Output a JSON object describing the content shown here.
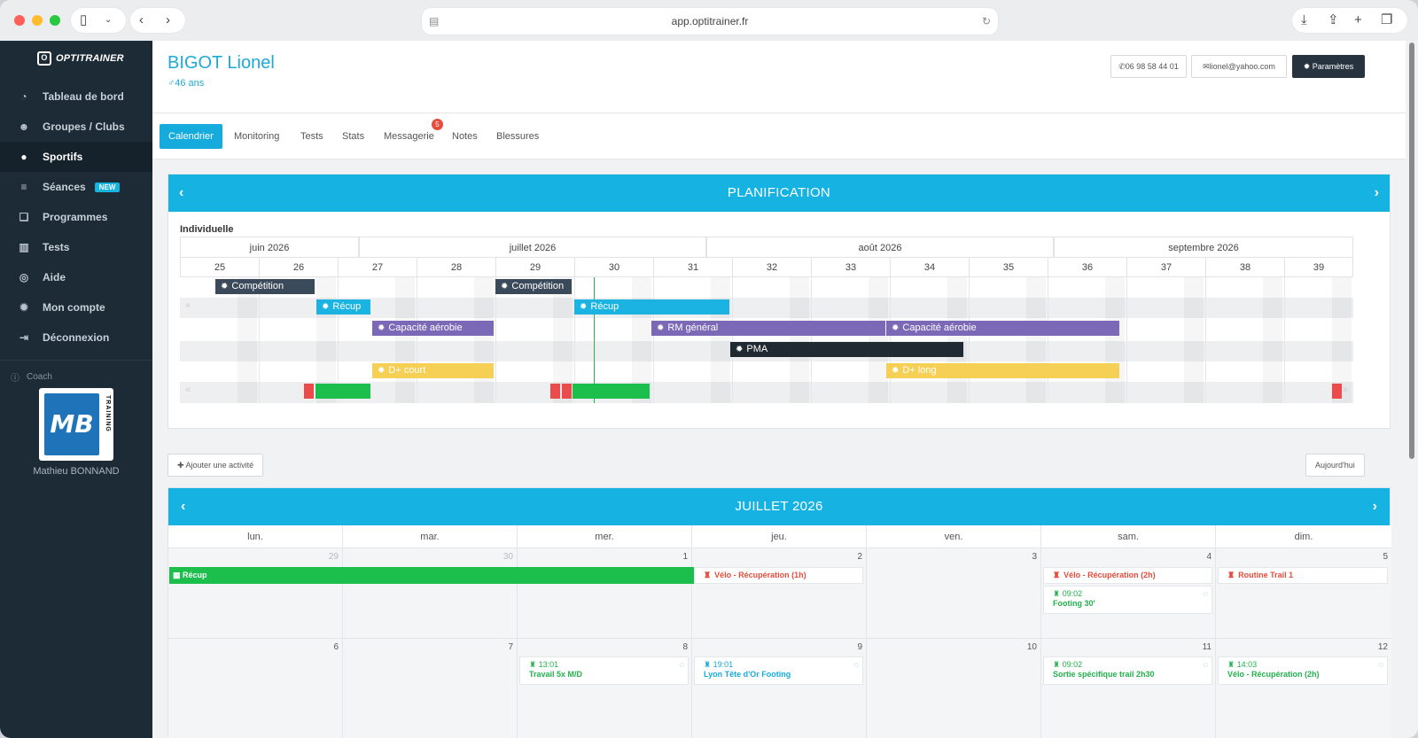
{
  "browser": {
    "url": "app.optitrainer.fr"
  },
  "sidebar": {
    "brand": "OPTITRAINER",
    "items": [
      {
        "label": "Tableau de bord",
        "icon": "dashboard-icon"
      },
      {
        "label": "Groupes / Clubs",
        "icon": "users-icon"
      },
      {
        "label": "Sportifs",
        "icon": "user-icon"
      },
      {
        "label": "Séances",
        "icon": "database-icon",
        "badge": "NEW"
      },
      {
        "label": "Programmes",
        "icon": "copy-icon"
      },
      {
        "label": "Tests",
        "icon": "bar-chart-icon"
      },
      {
        "label": "Aide",
        "icon": "lifebuoy-icon"
      },
      {
        "label": "Mon compte",
        "icon": "gear-icon"
      },
      {
        "label": "Déconnexion",
        "icon": "sign-out-icon"
      }
    ],
    "coach_label": "Coach",
    "coach_logo_text": "MB",
    "coach_logo_side": "TRAINING",
    "coach_name": "Mathieu BONNAND"
  },
  "athlete": {
    "name": "BIGOT Lionel",
    "age": "46 ans"
  },
  "header_buttons": {
    "phone": "06 98 58 44 01",
    "email": "lionel@yahoo.com",
    "settings": "Paramètres"
  },
  "tabs": [
    {
      "label": "Calendrier"
    },
    {
      "label": "Monitoring"
    },
    {
      "label": "Tests"
    },
    {
      "label": "Stats"
    },
    {
      "label": "Messagerie",
      "badge": "5"
    },
    {
      "label": "Notes"
    },
    {
      "label": "Blessures"
    }
  ],
  "planification": {
    "title": "PLANIFICATION",
    "section": "Individuelle",
    "months": [
      "juin 2026",
      "juillet 2026",
      "août 2026",
      "septembre 2026"
    ],
    "weeks": [
      "25",
      "26",
      "27",
      "28",
      "29",
      "30",
      "31",
      "32",
      "33",
      "34",
      "35",
      "36",
      "37",
      "38",
      "39"
    ],
    "bars": [
      {
        "label": "Compétition"
      },
      {
        "label": "Compétition"
      },
      {
        "label": "Récup"
      },
      {
        "label": "Récup"
      },
      {
        "label": "Capacité aérobie"
      },
      {
        "label": "RM général"
      },
      {
        "label": "Capacité aérobie"
      },
      {
        "label": "PMA"
      },
      {
        "label": "D+ court"
      },
      {
        "label": "D+ long"
      }
    ],
    "colors": {
      "competition": "#3b4a5a",
      "recup": "#1ab3e2",
      "aerobie": "#7b68b6",
      "pma": "#1f2a33",
      "denivele": "#f6cf55",
      "green": "#1cbf4c",
      "red": "#ec4b4b"
    }
  },
  "actions": {
    "add_activity": "Ajouter une activité",
    "today": "Aujourd'hui"
  },
  "month_calendar": {
    "title": "JUILLET 2026",
    "days": [
      "lun.",
      "mar.",
      "mer.",
      "jeu.",
      "ven.",
      "sam.",
      "dim."
    ],
    "week1": [
      "29",
      "30",
      "1",
      "2",
      "3",
      "4",
      "5"
    ],
    "week2": [
      "6",
      "7",
      "8",
      "9",
      "10",
      "11",
      "12"
    ],
    "span_event": "Récup",
    "events": [
      {
        "title": "Vélo - Récupération (1h)"
      },
      {
        "title": "Vélo - Récupération (2h)"
      },
      {
        "time": "09:02",
        "title": "Footing 30'"
      },
      {
        "title": "Routine Trail 1"
      },
      {
        "time": "13:01",
        "title": "Travail 5x M/D"
      },
      {
        "time": "19:01",
        "title": "Lyon Tête d'Or Footing"
      },
      {
        "time": "09:02",
        "title": "Sortie spécifique trail 2h30"
      },
      {
        "time": "14:03",
        "title": "Vélo - Récupération (2h)"
      }
    ]
  }
}
